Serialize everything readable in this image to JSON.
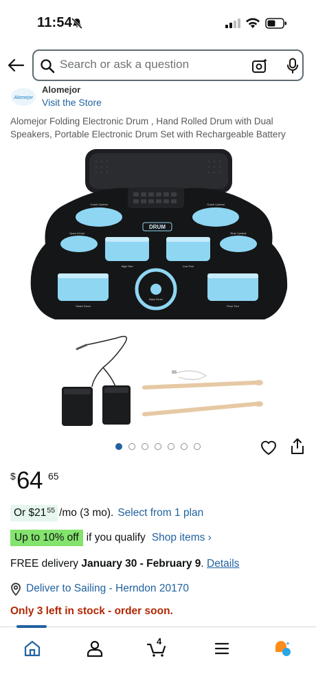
{
  "status_bar": {
    "time": "11:54",
    "icons": [
      "bell-off-icon",
      "signal-icon",
      "wifi-icon",
      "battery-icon"
    ]
  },
  "search": {
    "placeholder": "Search or ask a question",
    "icons": [
      "back-arrow-icon",
      "search-icon",
      "camera-lens-icon",
      "microphone-icon"
    ]
  },
  "store": {
    "logo_text": "Alomejor",
    "name": "Alomejor",
    "visit_label": "Visit the Store"
  },
  "product": {
    "title": "Alomejor Folding Electronic Drum , Hand Rolled Drum with Dual Speakers, Portable Electronic Drum Set with Rechargeable Battery",
    "image_label": "DRUM",
    "pad_labels": [
      "Crash Cymbal",
      "Crash Cymbal",
      "Open Hi-hat",
      "Ride Cymbal",
      "High Tom",
      "Low Tom",
      "Snare Drum",
      "Bass Drum",
      "Floor Tom"
    ],
    "image_count": 7,
    "active_image": 1
  },
  "price": {
    "currency": "$",
    "whole": "64",
    "fraction": "65"
  },
  "installment": {
    "prefix": "Or $",
    "amount_whole": "21",
    "amount_fraction": "55",
    "suffix": " /mo (3 mo).",
    "link": "Select from 1 plan"
  },
  "discount": {
    "badge": "Up to 10% off",
    "text": "if you qualify",
    "link": "Shop items ›"
  },
  "delivery": {
    "prefix": "FREE delivery ",
    "dates": "January 30 - February 9",
    "suffix": ". ",
    "link": "Details"
  },
  "deliver_to": {
    "text": "Deliver to Sailing - Herndon 20170"
  },
  "stock": {
    "text": "Only 3 left in stock - order soon."
  },
  "bottom_nav": {
    "items": [
      "home-icon",
      "account-icon",
      "cart-icon",
      "menu-icon",
      "rufus-icon"
    ],
    "cart_count": "4"
  },
  "colors": {
    "link": "#2162a1",
    "stock": "#b12704",
    "badge_green": "#83e36d",
    "pill_green": "#e6f6ee",
    "pad_blue": "#8fd6f3"
  }
}
